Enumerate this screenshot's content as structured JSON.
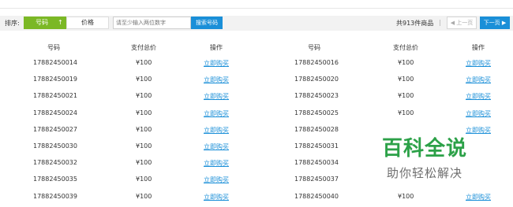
{
  "toolbar": {
    "sort_label": "排序:",
    "sort_number": "号码",
    "sort_arrow": "↑",
    "sort_price": "价格",
    "search_placeholder": "请至少输入两位数字",
    "search_button": "搜索号码",
    "total": "共913件商品",
    "divider": "|",
    "prev": "◀ 上一页",
    "next": "下一页 ▶"
  },
  "table": {
    "headers": [
      "号码",
      "支付总价",
      "操作"
    ],
    "buy_label": "立即购买",
    "left": [
      {
        "number": "17882450014",
        "price": "¥100"
      },
      {
        "number": "17882450019",
        "price": "¥100"
      },
      {
        "number": "17882450021",
        "price": "¥100"
      },
      {
        "number": "17882450024",
        "price": "¥100"
      },
      {
        "number": "17882450027",
        "price": "¥100"
      },
      {
        "number": "17882450030",
        "price": "¥100"
      },
      {
        "number": "17882450032",
        "price": "¥100"
      },
      {
        "number": "17882450035",
        "price": "¥100"
      },
      {
        "number": "17882450039",
        "price": "¥100"
      }
    ],
    "right": [
      {
        "number": "17882450016",
        "price": "¥100"
      },
      {
        "number": "17882450020",
        "price": "¥100"
      },
      {
        "number": "17882450023",
        "price": "¥100"
      },
      {
        "number": "17882450025",
        "price": "¥100"
      },
      {
        "number": "17882450028",
        "price": ""
      },
      {
        "number": "17882450031",
        "price": ""
      },
      {
        "number": "17882450034",
        "price": ""
      },
      {
        "number": "17882450037",
        "price": ""
      },
      {
        "number": "17882450040",
        "price": "¥100"
      }
    ]
  },
  "watermark": {
    "title": "百科全说",
    "subtitle": "助你轻松解决"
  },
  "colors": {
    "accent_green": "#7bb825",
    "link_blue": "#1a8fd8",
    "watermark_green": "#2ca148"
  }
}
